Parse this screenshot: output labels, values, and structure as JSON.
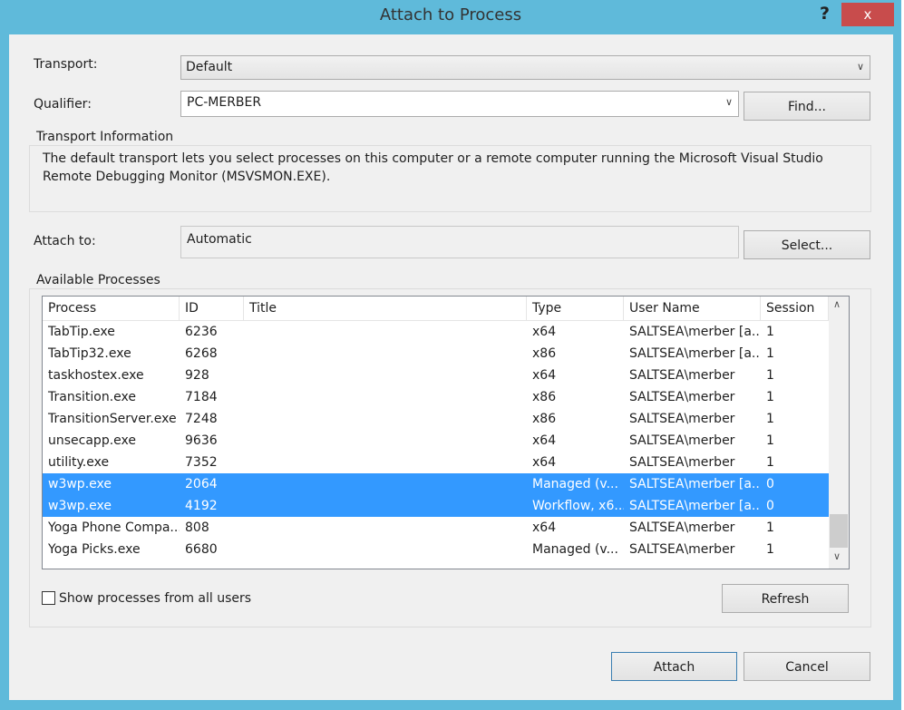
{
  "window": {
    "title": "Attach to Process",
    "help": "?",
    "close": "x"
  },
  "transport": {
    "label": "Transport:",
    "value": "Default"
  },
  "qualifier": {
    "label": "Qualifier:",
    "value": "PC-MERBER",
    "find": "Find..."
  },
  "transport_info": {
    "label": "Transport Information",
    "text": "The default transport lets you select processes on this computer or a remote computer running the Microsoft Visual Studio Remote Debugging Monitor (MSVSMON.EXE)."
  },
  "attach_to": {
    "label": "Attach to:",
    "value": "Automatic",
    "select": "Select..."
  },
  "processes": {
    "label": "Available Processes",
    "columns": [
      "Process",
      "ID",
      "Title",
      "Type",
      "User Name",
      "Session"
    ],
    "rows": [
      {
        "process": "TabTip.exe",
        "id": "6236",
        "title": "",
        "type": "x64",
        "user": "SALTSEA\\merber [a...",
        "session": "1",
        "selected": false
      },
      {
        "process": "TabTip32.exe",
        "id": "6268",
        "title": "",
        "type": "x86",
        "user": "SALTSEA\\merber [a...",
        "session": "1",
        "selected": false
      },
      {
        "process": "taskhostex.exe",
        "id": "928",
        "title": "",
        "type": "x64",
        "user": "SALTSEA\\merber",
        "session": "1",
        "selected": false
      },
      {
        "process": "Transition.exe",
        "id": "7184",
        "title": "",
        "type": "x86",
        "user": "SALTSEA\\merber",
        "session": "1",
        "selected": false
      },
      {
        "process": "TransitionServer.exe",
        "id": "7248",
        "title": "",
        "type": "x86",
        "user": "SALTSEA\\merber",
        "session": "1",
        "selected": false
      },
      {
        "process": "unsecapp.exe",
        "id": "9636",
        "title": "",
        "type": "x64",
        "user": "SALTSEA\\merber",
        "session": "1",
        "selected": false
      },
      {
        "process": "utility.exe",
        "id": "7352",
        "title": "",
        "type": "x64",
        "user": "SALTSEA\\merber",
        "session": "1",
        "selected": false
      },
      {
        "process": "w3wp.exe",
        "id": "2064",
        "title": "",
        "type": "Managed (v...",
        "user": "SALTSEA\\merber [a...",
        "session": "0",
        "selected": true
      },
      {
        "process": "w3wp.exe",
        "id": "4192",
        "title": "",
        "type": "Workflow, x6...",
        "user": "SALTSEA\\merber [a...",
        "session": "0",
        "selected": true
      },
      {
        "process": "Yoga Phone Compa...",
        "id": "808",
        "title": "",
        "type": "x64",
        "user": "SALTSEA\\merber",
        "session": "1",
        "selected": false
      },
      {
        "process": "Yoga Picks.exe",
        "id": "6680",
        "title": "",
        "type": "Managed (v...",
        "user": "SALTSEA\\merber",
        "session": "1",
        "selected": false
      }
    ],
    "show_all_users": {
      "label": "Show processes from all users",
      "checked": false
    },
    "refresh": "Refresh"
  },
  "buttons": {
    "attach": "Attach",
    "cancel": "Cancel"
  },
  "colors": {
    "frame": "#5fbada",
    "close": "#c84c4c",
    "selection": "#3399ff"
  }
}
